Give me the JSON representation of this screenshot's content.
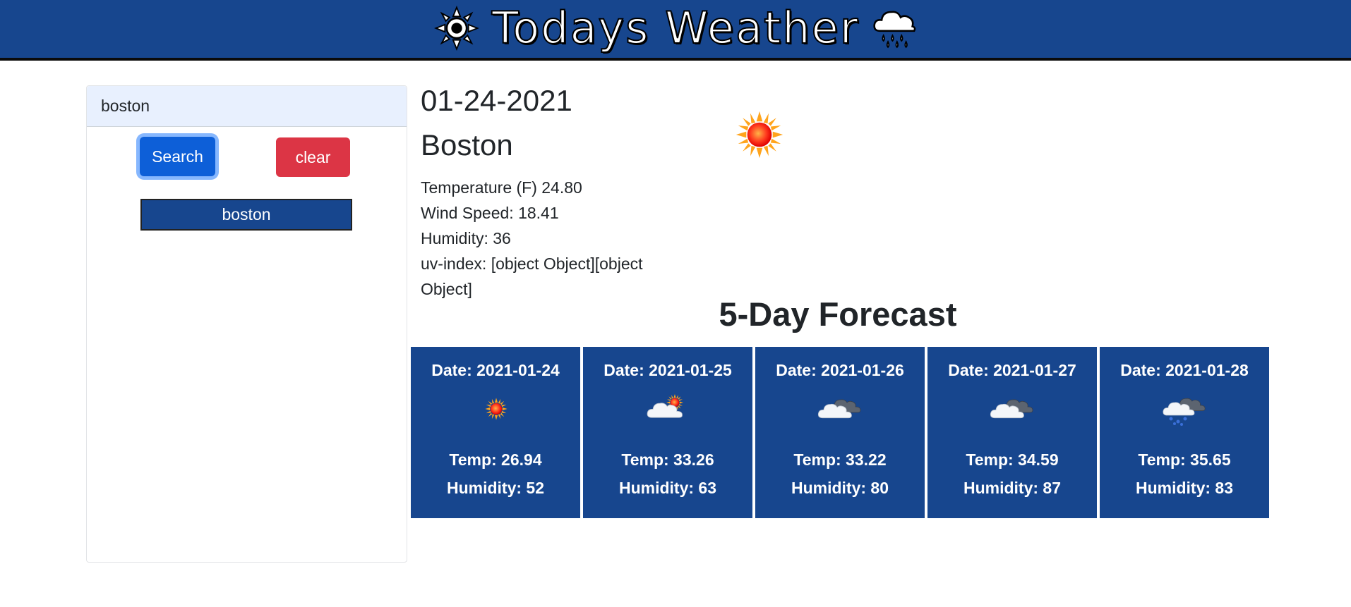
{
  "header": {
    "title": "Todays Weather",
    "left_icon": "sun-icon",
    "right_icon": "rain-cloud-icon",
    "background": "#17468e"
  },
  "sidebar": {
    "search_value": "boston",
    "search_button": "Search",
    "clear_button": "clear",
    "history": [
      "boston"
    ]
  },
  "current": {
    "date": "01-24-2021",
    "city": "Boston",
    "icon": "sun-icon",
    "temperature": "Temperature (F) 24.80",
    "wind": "Wind Speed: 18.41",
    "humidity": "Humidity: 36",
    "uv": "uv-index: [object Object][object Object]"
  },
  "forecast": {
    "title": "5-Day Forecast",
    "days": [
      {
        "date": "Date: 2021-01-24",
        "icon": "sun-icon",
        "temp": "Temp: 26.94",
        "humidity": "Humidity: 52"
      },
      {
        "date": "Date: 2021-01-25",
        "icon": "partly-cloudy-icon",
        "temp": "Temp: 33.26",
        "humidity": "Humidity: 63"
      },
      {
        "date": "Date: 2021-01-26",
        "icon": "cloudy-icon",
        "temp": "Temp: 33.22",
        "humidity": "Humidity: 80"
      },
      {
        "date": "Date: 2021-01-27",
        "icon": "cloudy-icon",
        "temp": "Temp: 34.59",
        "humidity": "Humidity: 87"
      },
      {
        "date": "Date: 2021-01-28",
        "icon": "snow-cloud-icon",
        "temp": "Temp: 35.65",
        "humidity": "Humidity: 83"
      }
    ]
  },
  "colors": {
    "card_bg": "#17468e",
    "search_button": "#0d5fd8",
    "clear_button": "#dc3545"
  }
}
